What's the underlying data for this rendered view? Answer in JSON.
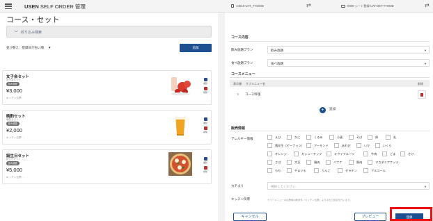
{
  "app": {
    "brand_bold": "USEN",
    "brand_rest": " SELF ORDER 管理",
    "account": "A4810-UAT_TYS/MD",
    "device": "0000-シート登録-UAT-DET-TTOMD",
    "swap_icon": "⇄"
  },
  "left": {
    "title": "コース・セット",
    "filter_label": "絞り込み検索",
    "sort_label": "並び替え：登録日が古い順",
    "add_button": "追加",
    "cards": [
      {
        "name": "女子会セット",
        "sub": "女子会セット",
        "badge": "飲み放題",
        "price": "¥3,000",
        "kitchen": "キッチン伝票：-",
        "image": "drink-fruit",
        "copy": "複製",
        "del": "削除"
      },
      {
        "name": "晩酌セット",
        "sub": "晩酌セット",
        "badge": "飲み放題",
        "price": "¥2,000",
        "kitchen": "キッチン伝票：-",
        "image": "beer",
        "copy": "複製",
        "del": "削除"
      },
      {
        "name": "誕生日セット",
        "sub": "誕生日セット",
        "badge": "飲み放題",
        "price": "¥5,000",
        "kitchen": "キッチン伝票：-",
        "image": "pizza",
        "copy": "複製",
        "del": "削除"
      }
    ]
  },
  "right": {
    "course_title": "コース内容",
    "drink_label": "飲み放題プラン",
    "drink_value": "飲み放題",
    "food_label": "食べ放題プラン",
    "food_value": "食べ放題",
    "menu_title": "コースメニュー",
    "col_order": "表示順",
    "col_sub": "サブメニュー名",
    "col_del": "削除",
    "sub_item": "コース料理",
    "add_label": "追加",
    "sales_title": "販売情報",
    "allergy_label": "アレルギー情報",
    "allergy_rows": [
      [
        "えび",
        "かに",
        "くるみ",
        "小麦",
        "そば",
        "卵",
        "乳"
      ],
      [
        "落花生（ピーナッツ）",
        "アーモンド",
        "あわび",
        "いか",
        "いくら"
      ],
      [
        "オレンジ",
        "カシューナッツ",
        "キウイフルーツ",
        "牛肉",
        "ごま",
        "さけ"
      ],
      [
        "さば",
        "大豆",
        "鶏肉",
        "バナナ",
        "豚肉",
        "マカダミアナッツ"
      ],
      [
        "もも",
        "やまいも",
        "りんご",
        "ゼラチン",
        "アルコール"
      ]
    ],
    "category_label": "カテゴリ",
    "category_placeholder": "選択してください",
    "kitchen_label": "キッチン伝票",
    "kitchen_note": "サイドメニューの伝票時印刷条件「キッチン伝票」よりの出力設定を行います。"
  },
  "footer": {
    "cancel": "キャンセル",
    "preview": "プレビュー",
    "register": "登録"
  },
  "colors": {
    "primary": "#1d4f91",
    "highlight": "#ee1010",
    "delete": "#b83232"
  }
}
